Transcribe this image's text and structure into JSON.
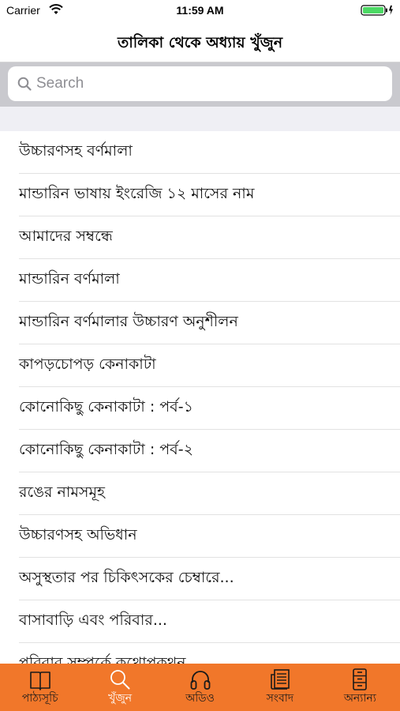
{
  "status_bar": {
    "carrier": "Carrier",
    "time": "11:59 AM",
    "wifi_icon": "wifi-icon",
    "battery_icon": "battery-icon"
  },
  "nav": {
    "title": "তালিকা থেকে অধ্যায় খুঁজুন"
  },
  "search": {
    "placeholder": "Search",
    "value": "",
    "icon": "search-icon"
  },
  "chapters": [
    "উচ্চারণসহ বর্ণমালা",
    "মান্ডারিন ভাষায় ইংরেজি ১২ মাসের নাম",
    "আমাদের সম্বন্ধে",
    "মান্ডারিন বর্ণমালা",
    "মান্ডারিন বর্ণমালার উচ্চারণ অনুশীলন",
    "কাপড়চোপড় কেনাকাটা",
    "কোনোকিছু কেনাকাটা : পর্ব-১",
    "কোনোকিছু কেনাকাটা : পর্ব-২",
    "রঙের নামসমূহ",
    "উচ্চারণসহ অভিধান",
    "অসুস্থতার পর চিকিৎসকের চেম্বারে...",
    "বাসাবাড়ি এবং পরিবার...",
    "পরিবার সম্পর্কে কথোপকথন"
  ],
  "tabs": [
    {
      "label": "পাঠ্যসূচি",
      "icon": "book-icon",
      "active": false
    },
    {
      "label": "খুঁজুন",
      "icon": "search-icon",
      "active": true
    },
    {
      "label": "অডিও",
      "icon": "headphones-icon",
      "active": false
    },
    {
      "label": "সংবাদ",
      "icon": "newspaper-icon",
      "active": false
    },
    {
      "label": "অন্যান্য",
      "icon": "cabinet-icon",
      "active": false
    }
  ],
  "colors": {
    "tab_bar": "#f1772a",
    "tab_active_label": "#ffffff",
    "tab_inactive_label": "#1a1a1a",
    "search_area": "#c9c9ce"
  }
}
